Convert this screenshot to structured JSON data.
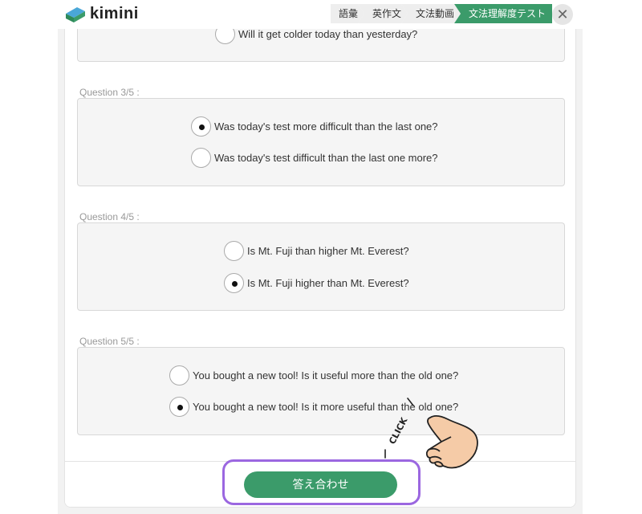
{
  "app": {
    "name": "kimini"
  },
  "nav": {
    "crumbs": [
      "語彙",
      "英作文",
      "文法動画",
      "文法理解度テスト"
    ],
    "close_symbol": "✕"
  },
  "questions": [
    {
      "label": "",
      "options": [
        {
          "text": "Will it get colder today than yesterday?",
          "checked": false
        }
      ]
    },
    {
      "label": "Question 3/5 :",
      "options": [
        {
          "text": "Was today's test more difficult than the last one?",
          "checked": true
        },
        {
          "text": "Was today's test difficult than the last one more?",
          "checked": false
        }
      ]
    },
    {
      "label": "Question 4/5 :",
      "options": [
        {
          "text": "Is Mt. Fuji than higher Mt. Everest?",
          "checked": false
        },
        {
          "text": "Is Mt. Fuji higher than Mt. Everest?",
          "checked": true
        }
      ]
    },
    {
      "label": "Question 5/5 :",
      "options": [
        {
          "text": "You bought a new tool! Is it useful more than the old one?",
          "checked": false
        },
        {
          "text": "You bought a new tool! Is it more useful than the old one?",
          "checked": true
        }
      ]
    }
  ],
  "footer": {
    "submit_label": "答え合わせ"
  },
  "overlay": {
    "click_text": "CLICK"
  },
  "colors": {
    "accent": "#3b9b6a",
    "highlight": "#9b67e0",
    "hand": "#f5cba7"
  }
}
